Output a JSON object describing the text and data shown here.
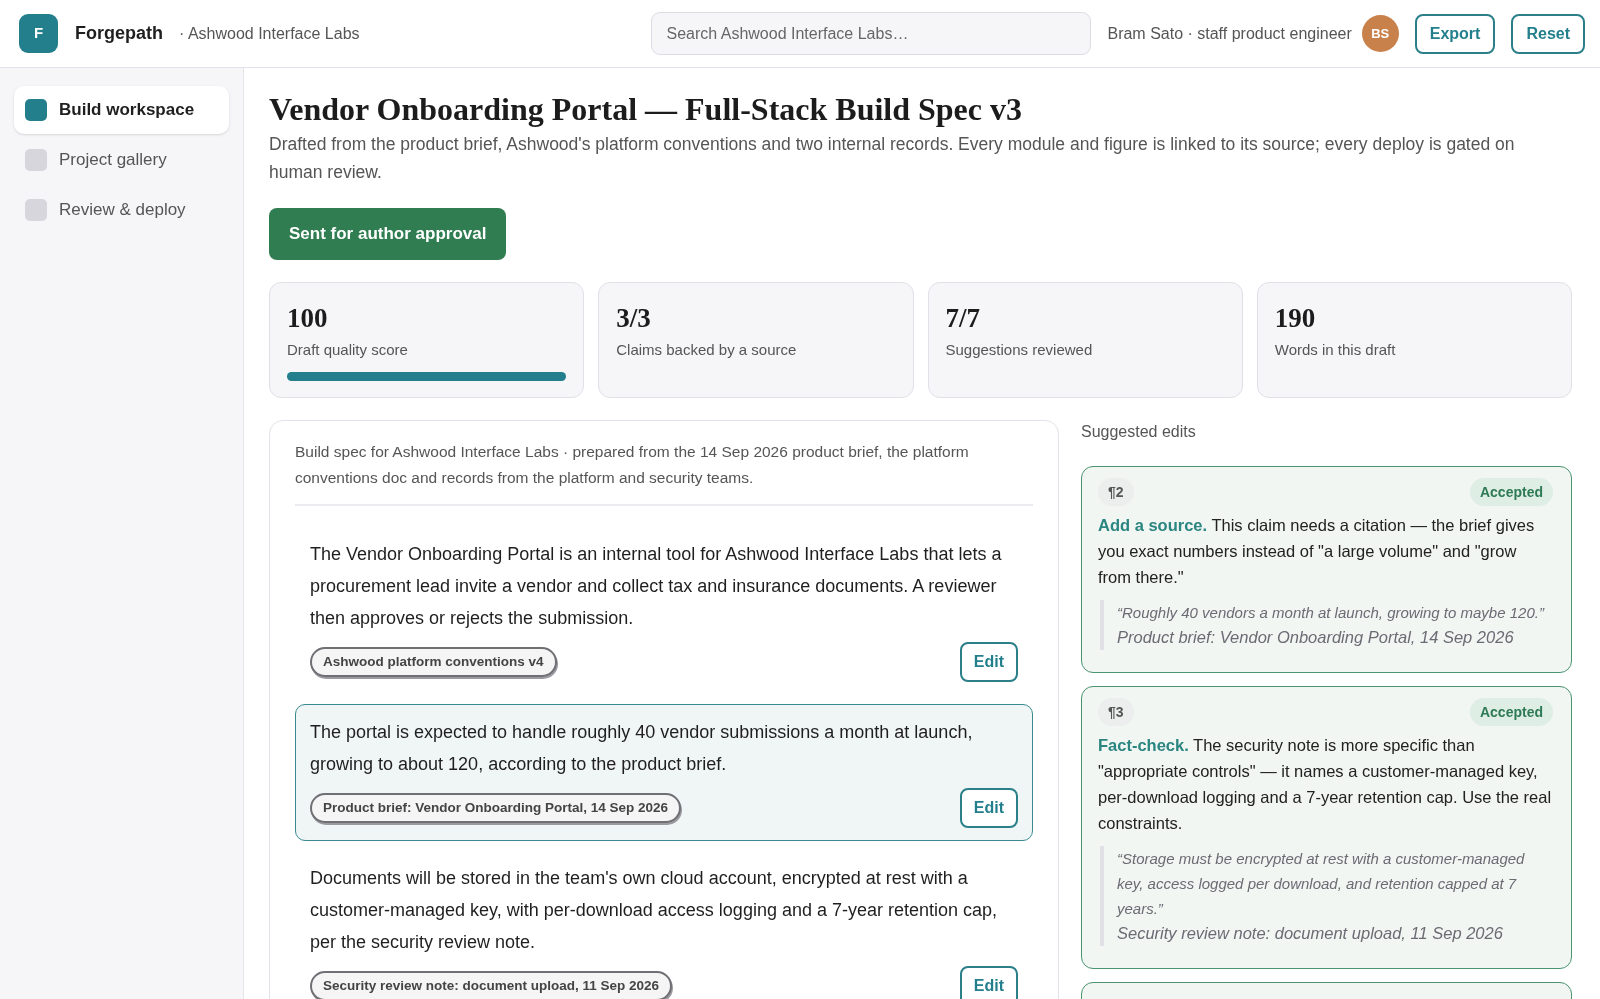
{
  "app": {
    "logo_letter": "F",
    "name": "Forgepath",
    "workspace": "· Ashwood Interface Labs"
  },
  "search": {
    "placeholder": "Search Ashwood Interface Labs…"
  },
  "user": {
    "label": "Bram Sato · staff product engineer",
    "initials": "BS"
  },
  "header_buttons": [
    "Export",
    "Reset"
  ],
  "sidebar": {
    "items": [
      {
        "label": "Build workspace",
        "selected": true
      },
      {
        "label": "Project gallery",
        "selected": false
      },
      {
        "label": "Review & deploy",
        "selected": false
      }
    ]
  },
  "document": {
    "title": "Vendor Onboarding Portal — Full-Stack Build Spec v3",
    "subtitle": "Drafted from the product brief, Ashwood's platform conventions and two internal records. Every module and figure is linked to its source; every deploy is gated on human review.",
    "status_button": "Sent for author approval"
  },
  "stats": [
    {
      "value": "100",
      "label": "Draft quality score",
      "level": 1
    },
    {
      "value": "3/3",
      "label": "Claims backed by a source"
    },
    {
      "value": "7/7",
      "label": "Suggestions reviewed"
    },
    {
      "value": "190",
      "label": "Words in this draft"
    }
  ],
  "spec": {
    "intro": "Build spec for Ashwood Interface Labs · prepared from the 14 Sep 2026 product brief, the platform conventions doc and records from the platform and security teams.",
    "blocks": [
      {
        "text": "The Vendor Onboarding Portal is an internal tool for Ashwood Interface Labs that lets a procurement lead invite a vendor and collect tax and insurance documents. A reviewer then approves or rejects the submission.",
        "source": "Ashwood platform conventions v4",
        "action": "Edit",
        "selected": false
      },
      {
        "text": "The portal is expected to handle roughly 40 vendor submissions a month at launch, growing to about 120, according to the product brief.",
        "source": "Product brief: Vendor Onboarding Portal, 14 Sep 2026",
        "action": "Edit",
        "selected": true
      },
      {
        "text": "Documents will be stored in the team's own cloud account, encrypted at rest with a customer-managed key, with per-download access logging and a 7-year retention cap, per the security review note.",
        "source": "Security review note: document upload, 11 Sep 2026",
        "action": "Edit",
        "selected": false
      }
    ]
  },
  "suggestions": {
    "heading": "Suggested edits",
    "items": [
      {
        "paragraph": "¶2",
        "status": "Accepted",
        "text": "**Add a source.** This claim needs a citation — the brief gives you exact numbers instead of \"a large volume\" and \"grow from there.\"",
        "quote": "“Roughly 40 vendors a month at launch, growing to maybe 120.”",
        "source": "Product brief: Vendor Onboarding Portal, 14 Sep 2026"
      },
      {
        "paragraph": "¶3",
        "status": "Accepted",
        "text": "**Fact-check.** The security note is more specific than \"appropriate controls\" — it names a customer-managed key, per-download logging and a 7-year retention cap. Use the real constraints.",
        "quote": "“Storage must be encrypted at rest with a customer-managed key, access logged per download, and retention capped at 7 years.”",
        "source": "Security review note: document upload, 11 Sep 2026"
      }
    ]
  }
}
